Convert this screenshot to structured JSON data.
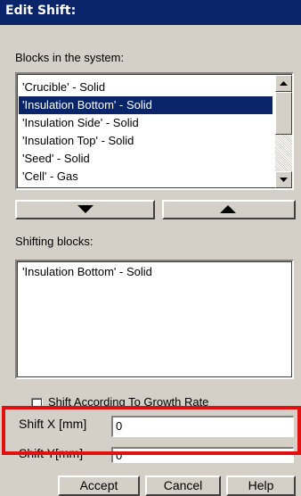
{
  "dialog": {
    "title": "Edit Shift:"
  },
  "blocks_section": {
    "label": "Blocks in the system:",
    "items": [
      {
        "label": "'Crucible' - Solid"
      },
      {
        "label": "'Insulation Bottom' - Solid"
      },
      {
        "label": "'Insulation Side' - Solid"
      },
      {
        "label": "'Insulation Top' - Solid"
      },
      {
        "label": "'Seed' - Solid"
      },
      {
        "label": "'Cell' - Gas"
      }
    ]
  },
  "shifting_section": {
    "label": "Shifting blocks:",
    "items": [
      {
        "label": "'Insulation Bottom' - Solid"
      }
    ]
  },
  "options": {
    "growth_rate_label": "Shift According To Growth Rate",
    "growth_rate_checked": false
  },
  "fields": {
    "shift_x": {
      "label": "Shift X [mm]",
      "value": "0"
    },
    "shift_y": {
      "label": "Shift Y[mm]",
      "value": "0"
    }
  },
  "buttons": {
    "accept": "Accept",
    "cancel": "Cancel",
    "help": "Help"
  },
  "colors": {
    "highlight": "#e01010",
    "selection": "#0a246a",
    "dialog_bg": "#d4d0c8"
  },
  "icons": {
    "move_down": "triangle-down",
    "move_up": "triangle-up"
  }
}
